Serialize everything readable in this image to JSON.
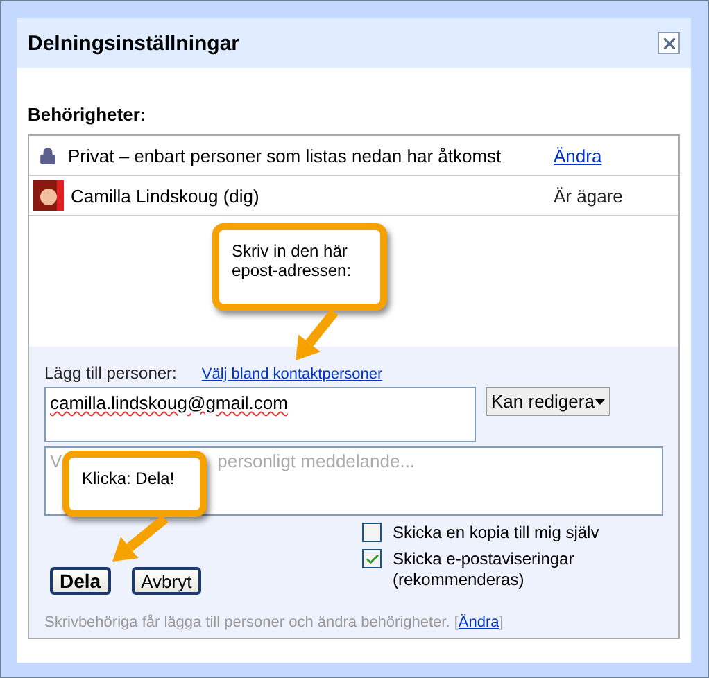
{
  "dialog": {
    "title": "Delningsinställningar"
  },
  "permissions": {
    "heading": "Behörigheter:",
    "rows": [
      {
        "kind": "visibility",
        "text": "Privat – enbart personer som listas nedan har åtkomst",
        "action": "Ändra"
      },
      {
        "kind": "person",
        "text": "Camilla Lindskoug (dig)",
        "action": "Är ägare"
      }
    ]
  },
  "add_people": {
    "label": "Lägg till personer:",
    "link": "Välj bland kontaktpersoner",
    "email_value": "camilla.lindskoug@gmail.com",
    "permission_dropdown": "Kan redigera",
    "message_placeholder_start": "V",
    "message_placeholder_end": "personligt meddelande..."
  },
  "options": [
    {
      "label": "Skicka en kopia till mig själv",
      "checked": false
    },
    {
      "label": "Skicka e-postaviseringar (rekommenderas)",
      "checked": true
    }
  ],
  "buttons": [
    {
      "label": "Dela",
      "primary": true
    },
    {
      "label": "Avbryt",
      "primary": false
    }
  ],
  "footer": {
    "text": "Skrivbehöriga får lägga till personer och ändra behörigheter. [",
    "link": "Ändra",
    "after": "]"
  },
  "callouts": [
    {
      "text": "Skriv in den här epost-adressen:"
    },
    {
      "text": "Klicka: Dela!"
    }
  ]
}
